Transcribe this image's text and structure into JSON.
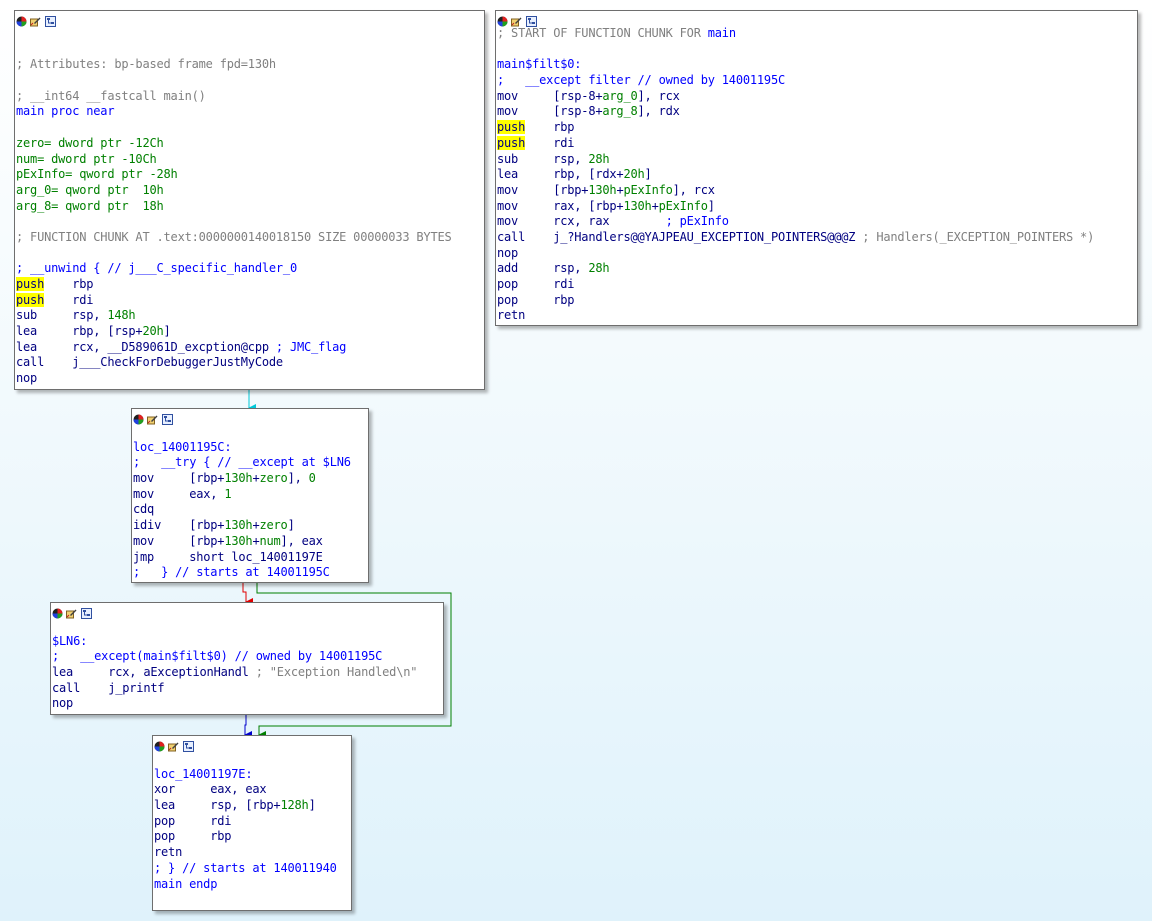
{
  "colors": {
    "comment": "#808080",
    "label": "#0000ff",
    "number": "#008000",
    "mnemonic": "#000080",
    "highlight": "#ffff00",
    "edge_normal": "#00c8d8",
    "edge_false": "#e00000",
    "edge_true": "#007f00",
    "edge_uncond": "#0000cc"
  },
  "titlebar_icons": [
    "node-color-icon",
    "rename-icon",
    "graph-view-icon"
  ],
  "nodes": [
    {
      "id": "main-entry",
      "lines": [
        [],
        [],
        [
          {
            "t": "; Attributes: bp-based frame fpd=130h",
            "c": "gray"
          }
        ],
        [],
        [
          {
            "t": "; __int64 __fastcall main()",
            "c": "gray"
          }
        ],
        [
          {
            "t": "main proc near",
            "c": "blue"
          }
        ],
        [],
        [
          {
            "t": "zero= dword ptr -12Ch",
            "c": "green"
          }
        ],
        [
          {
            "t": "num= dword ptr -10Ch",
            "c": "green"
          }
        ],
        [
          {
            "t": "pExInfo= qword ptr -28h",
            "c": "green"
          }
        ],
        [
          {
            "t": "arg_0= qword ptr  10h",
            "c": "green"
          }
        ],
        [
          {
            "t": "arg_8= qword ptr  18h",
            "c": "green"
          }
        ],
        [],
        [
          {
            "t": "; FUNCTION CHUNK AT .text:0000000140018150 SIZE 00000033 BYTES",
            "c": "gray"
          }
        ],
        [],
        [
          {
            "t": "; __unwind { // j___C_specific_handler_0",
            "c": "blue"
          }
        ],
        [
          {
            "t": "push",
            "c": "navy",
            "hl": true
          },
          {
            "t": "    rbp",
            "c": "navy"
          }
        ],
        [
          {
            "t": "push",
            "c": "navy",
            "hl": true
          },
          {
            "t": "    rdi",
            "c": "navy"
          }
        ],
        [
          {
            "t": "sub     rsp, ",
            "c": "navy"
          },
          {
            "t": "148h",
            "c": "green"
          }
        ],
        [
          {
            "t": "lea     rbp, [rsp+",
            "c": "navy"
          },
          {
            "t": "20h",
            "c": "green"
          },
          {
            "t": "]",
            "c": "navy"
          }
        ],
        [
          {
            "t": "lea     rcx, __D589061D_excption@cpp ",
            "c": "navy"
          },
          {
            "t": "; JMC_flag",
            "c": "blue"
          }
        ],
        [
          {
            "t": "call    j___CheckForDebuggerJustMyCode",
            "c": "navy"
          }
        ],
        [
          {
            "t": "nop",
            "c": "navy"
          }
        ]
      ]
    },
    {
      "id": "filter-chunk",
      "lines": [
        [
          {
            "t": "; START OF FUNCTION CHUNK FOR ",
            "c": "gray"
          },
          {
            "t": "main",
            "c": "blue"
          }
        ],
        [],
        [
          {
            "t": "main$filt$0:",
            "c": "blue"
          }
        ],
        [
          {
            "t": ";   __except filter // owned by 14001195C",
            "c": "blue"
          }
        ],
        [
          {
            "t": "mov     [rsp-8+",
            "c": "navy"
          },
          {
            "t": "arg_0",
            "c": "green"
          },
          {
            "t": "], rcx",
            "c": "navy"
          }
        ],
        [
          {
            "t": "mov     [rsp-8+",
            "c": "navy"
          },
          {
            "t": "arg_8",
            "c": "green"
          },
          {
            "t": "], rdx",
            "c": "navy"
          }
        ],
        [
          {
            "t": "push",
            "c": "navy",
            "hl": true
          },
          {
            "t": "    rbp",
            "c": "navy"
          }
        ],
        [
          {
            "t": "push",
            "c": "navy",
            "hl": true
          },
          {
            "t": "    rdi",
            "c": "navy"
          }
        ],
        [
          {
            "t": "sub     rsp, ",
            "c": "navy"
          },
          {
            "t": "28h",
            "c": "green"
          }
        ],
        [
          {
            "t": "lea     rbp, [rdx+",
            "c": "navy"
          },
          {
            "t": "20h",
            "c": "green"
          },
          {
            "t": "]",
            "c": "navy"
          }
        ],
        [
          {
            "t": "mov     [rbp+",
            "c": "navy"
          },
          {
            "t": "130h",
            "c": "green"
          },
          {
            "t": "+",
            "c": "navy"
          },
          {
            "t": "pExInfo",
            "c": "green"
          },
          {
            "t": "], rcx",
            "c": "navy"
          }
        ],
        [
          {
            "t": "mov     rax, [rbp+",
            "c": "navy"
          },
          {
            "t": "130h",
            "c": "green"
          },
          {
            "t": "+",
            "c": "navy"
          },
          {
            "t": "pExInfo",
            "c": "green"
          },
          {
            "t": "]",
            "c": "navy"
          }
        ],
        [
          {
            "t": "mov     rcx, rax        ",
            "c": "navy"
          },
          {
            "t": "; pExInfo",
            "c": "blue"
          }
        ],
        [
          {
            "t": "call    j_?Handlers@@YAJPEAU_EXCEPTION_POINTERS@@@Z ",
            "c": "navy"
          },
          {
            "t": "; Handlers(_EXCEPTION_POINTERS *)",
            "c": "gray"
          }
        ],
        [
          {
            "t": "nop",
            "c": "navy"
          }
        ],
        [
          {
            "t": "add     rsp, ",
            "c": "navy"
          },
          {
            "t": "28h",
            "c": "green"
          }
        ],
        [
          {
            "t": "pop     rdi",
            "c": "navy"
          }
        ],
        [
          {
            "t": "pop     rbp",
            "c": "navy"
          }
        ],
        [
          {
            "t": "retn",
            "c": "navy"
          }
        ]
      ]
    },
    {
      "id": "try-block",
      "lines": [
        [],
        [
          {
            "t": "loc_14001195C:",
            "c": "blue"
          }
        ],
        [
          {
            "t": ";   __try { // __except at $LN6",
            "c": "blue"
          }
        ],
        [
          {
            "t": "mov     [rbp+",
            "c": "navy"
          },
          {
            "t": "130h",
            "c": "green"
          },
          {
            "t": "+",
            "c": "navy"
          },
          {
            "t": "zero",
            "c": "green"
          },
          {
            "t": "], ",
            "c": "navy"
          },
          {
            "t": "0",
            "c": "green"
          }
        ],
        [
          {
            "t": "mov     eax, ",
            "c": "navy"
          },
          {
            "t": "1",
            "c": "green"
          }
        ],
        [
          {
            "t": "cdq",
            "c": "navy"
          }
        ],
        [
          {
            "t": "idiv    [rbp+",
            "c": "navy"
          },
          {
            "t": "130h",
            "c": "green"
          },
          {
            "t": "+",
            "c": "navy"
          },
          {
            "t": "zero",
            "c": "green"
          },
          {
            "t": "]",
            "c": "navy"
          }
        ],
        [
          {
            "t": "mov     [rbp+",
            "c": "navy"
          },
          {
            "t": "130h",
            "c": "green"
          },
          {
            "t": "+",
            "c": "navy"
          },
          {
            "t": "num",
            "c": "green"
          },
          {
            "t": "], eax",
            "c": "navy"
          }
        ],
        [
          {
            "t": "jmp     short loc_14001197E",
            "c": "navy"
          }
        ],
        [
          {
            "t": ";   } // starts at 14001195C",
            "c": "blue"
          }
        ]
      ]
    },
    {
      "id": "except-block",
      "lines": [
        [],
        [
          {
            "t": "$LN6:",
            "c": "blue"
          }
        ],
        [
          {
            "t": ";   __except(main$filt$0) // owned by 14001195C",
            "c": "blue"
          }
        ],
        [
          {
            "t": "lea     rcx, aExceptionHandl ",
            "c": "navy"
          },
          {
            "t": "; \"Exception Handled\\n\"",
            "c": "gray"
          }
        ],
        [
          {
            "t": "call    j_printf",
            "c": "navy"
          }
        ],
        [
          {
            "t": "nop",
            "c": "navy"
          }
        ]
      ]
    },
    {
      "id": "exit-block",
      "lines": [
        [],
        [
          {
            "t": "loc_14001197E:",
            "c": "blue"
          }
        ],
        [
          {
            "t": "xor     eax, eax",
            "c": "navy"
          }
        ],
        [
          {
            "t": "lea     rsp, [rbp+",
            "c": "navy"
          },
          {
            "t": "128h",
            "c": "green"
          },
          {
            "t": "]",
            "c": "navy"
          }
        ],
        [
          {
            "t": "pop     rdi",
            "c": "navy"
          }
        ],
        [
          {
            "t": "pop     rbp",
            "c": "navy"
          }
        ],
        [
          {
            "t": "retn",
            "c": "navy"
          }
        ],
        [
          {
            "t": "; } // starts at 140011940",
            "c": "blue"
          }
        ],
        [
          {
            "t": "main endp",
            "c": "blue"
          }
        ]
      ]
    }
  ]
}
